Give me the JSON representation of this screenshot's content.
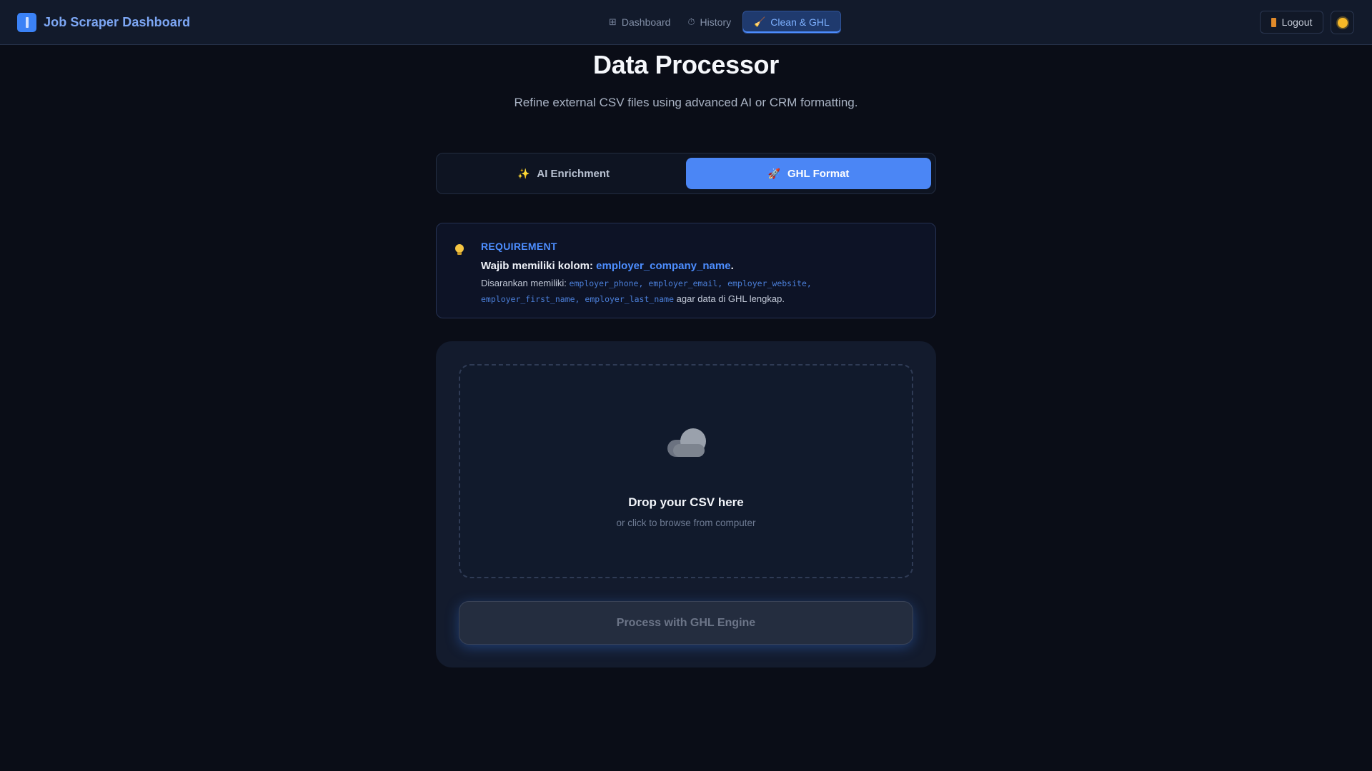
{
  "app": {
    "title": "Job Scraper Dashboard"
  },
  "nav": {
    "items": [
      {
        "label": "Dashboard",
        "icon": "grid-icon",
        "glyph": "⊞"
      },
      {
        "label": "History",
        "icon": "clock-icon",
        "glyph": "⏱"
      },
      {
        "label": "Clean & GHL",
        "icon": "broom-icon",
        "glyph": "🧹",
        "active": true
      }
    ]
  },
  "header_actions": {
    "logout_label": "Logout"
  },
  "page": {
    "title": "Data Processor",
    "subtitle": "Refine external CSV files using advanced AI or CRM formatting."
  },
  "mode_toggle": {
    "options": [
      {
        "label": "AI Enrichment",
        "icon": "sparkle-icon",
        "glyph": "✨"
      },
      {
        "label": "GHL Format",
        "icon": "rocket-icon",
        "glyph": "🚀",
        "selected": true
      }
    ]
  },
  "requirement": {
    "label": "REQUIREMENT",
    "required_prefix": "Wajib memiliki kolom: ",
    "required_column": "employer_company_name",
    "required_suffix": ".",
    "suggested_prefix": "Disarankan memiliki: ",
    "suggested_columns_line": "employer_phone, employer_email, employer_website,",
    "suggested_columns_line2": "employer_first_name, employer_last_name",
    "suggested_suffix": " agar data di GHL lengkap."
  },
  "upload": {
    "drop_title": "Drop your CSV here",
    "drop_subtitle": "or click to browse from computer",
    "process_label": "Process with GHL Engine"
  },
  "colors": {
    "background": "#0a0d17",
    "accent": "#4b86f5",
    "accent_text": "#4d8eff"
  }
}
